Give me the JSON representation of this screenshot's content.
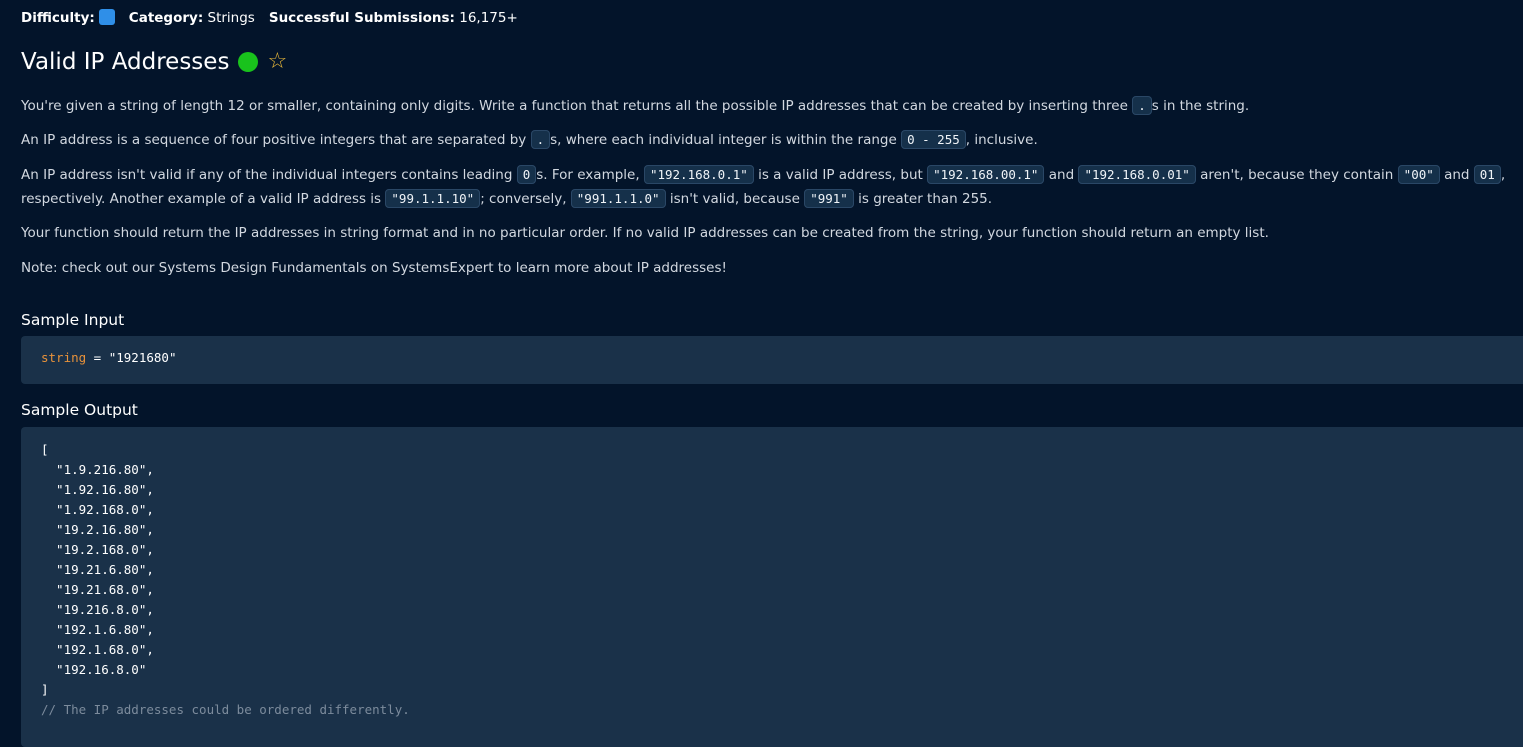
{
  "meta": {
    "difficulty_label": "Difficulty:",
    "category_label": "Category:",
    "category": "Strings",
    "submissions_label": "Successful Submissions:",
    "submissions": "16,175+",
    "difficulty_color": "#2f8fe8"
  },
  "title": "Valid IP Addresses",
  "status_icon": "completed-green-dot",
  "favorite_icon": "star-outline",
  "paragraphs": [
    [
      {
        "t": "You're given a string of length 12 or smaller, containing only digits. Write a function that returns all the possible IP addresses that can be created by inserting three "
      },
      {
        "c": "."
      },
      {
        "t": "s in the string."
      }
    ],
    [
      {
        "t": "An IP address is a sequence of four positive integers that are separated by "
      },
      {
        "c": "."
      },
      {
        "t": "s, where each individual integer is within the range "
      },
      {
        "c": "0 - 255"
      },
      {
        "t": ", inclusive."
      }
    ],
    [
      {
        "t": "An IP address isn't valid if any of the individual integers contains leading "
      },
      {
        "c": "0"
      },
      {
        "t": "s. For example, "
      },
      {
        "c": "\"192.168.0.1\""
      },
      {
        "t": " is a valid IP address, but "
      },
      {
        "c": "\"192.168.00.1\""
      },
      {
        "t": " and "
      },
      {
        "c": "\"192.168.0.01\""
      },
      {
        "t": " aren't, because they contain "
      },
      {
        "c": "\"00\""
      },
      {
        "t": " and "
      },
      {
        "c": "01"
      },
      {
        "t": ", respectively. Another example of a valid IP address is "
      },
      {
        "c": "\"99.1.1.10\""
      },
      {
        "t": "; conversely, "
      },
      {
        "c": "\"991.1.1.0\""
      },
      {
        "t": " isn't valid, because "
      },
      {
        "c": "\"991\""
      },
      {
        "t": " is greater than 255."
      }
    ],
    [
      {
        "t": "Your function should return the IP addresses in string format and in no particular order. If no valid IP addresses can be created from the string, your function should return an empty list."
      }
    ],
    [
      {
        "t": "Note: check out our Systems Design Fundamentals on SystemsExpert to learn more about IP addresses!"
      }
    ]
  ],
  "sample_input": {
    "heading": "Sample Input",
    "var": "string",
    "eq": " = ",
    "value": "\"1921680\""
  },
  "sample_output": {
    "heading": "Sample Output",
    "open": "[",
    "items": [
      "  \"1.9.216.80\",",
      "  \"1.92.16.80\",",
      "  \"1.92.168.0\",",
      "  \"19.2.16.80\",",
      "  \"19.2.168.0\",",
      "  \"19.21.6.80\",",
      "  \"19.21.68.0\",",
      "  \"19.216.8.0\",",
      "  \"192.1.6.80\",",
      "  \"192.1.68.0\",",
      "  \"192.16.8.0\""
    ],
    "close": "]",
    "comment": "// The IP addresses could be ordered differently."
  }
}
